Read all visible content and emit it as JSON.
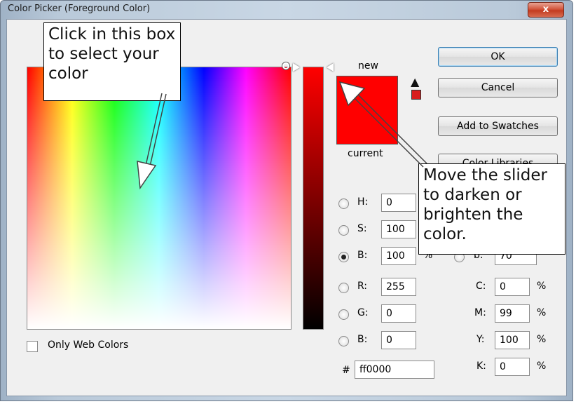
{
  "window": {
    "title": "Color Picker (Foreground Color)",
    "close_glyph": "x"
  },
  "labels": {
    "new": "new",
    "current": "current",
    "hash": "#",
    "only_web": "Only Web Colors"
  },
  "buttons": {
    "ok": "OK",
    "cancel": "Cancel",
    "add_swatches": "Add to Swatches",
    "color_libraries": "Color Libraries"
  },
  "hsb": {
    "h_label": "H:",
    "h_value": "0",
    "s_label": "S:",
    "s_value": "100",
    "b_label": "B:",
    "b_value": "100",
    "b_unit": "%"
  },
  "rgb": {
    "r_label": "R:",
    "r_value": "255",
    "g_label": "G:",
    "g_value": "0",
    "b_label": "B:",
    "b_value": "0"
  },
  "lab": {
    "b_label": "b:",
    "b_value": "70"
  },
  "cmyk": {
    "c_label": "C:",
    "c_value": "0",
    "m_label": "M:",
    "m_value": "99",
    "y_label": "Y:",
    "y_value": "100",
    "k_label": "K:",
    "k_value": "0",
    "unit": "%"
  },
  "hex": {
    "value": "ff0000"
  },
  "selected_mode": "B",
  "colors": {
    "new": "#ff0000",
    "current": "#ff0000",
    "gamut_warning": "#d81d1d"
  },
  "annotations": {
    "callout1": "Click in this box to select your color",
    "callout2": "Move the slider to darken or brighten the color."
  }
}
